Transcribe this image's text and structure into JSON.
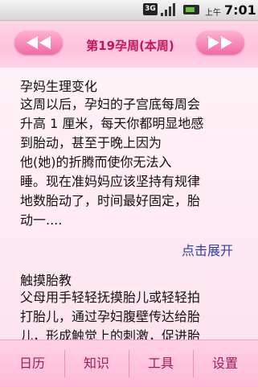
{
  "status": {
    "network": "3G",
    "ampm": "上午",
    "time": "7:01"
  },
  "header": {
    "week_title": "第19孕周(本周)"
  },
  "sections": [
    {
      "title": "孕妈生理变化",
      "lines": [
        "这周以后，孕妇的子宫底每周会",
        "升高 1 厘米，每天你都明显地感",
        "到胎动，甚至于晚上因为",
        "他(她)的折腾而使你无法入",
        "睡。现在准妈妈应该坚持有规律",
        "地数胎动了，时间最好固定，胎",
        "动一...."
      ],
      "expand_label": "点击展开"
    },
    {
      "title": "触摸胎教",
      "lines": [
        "父母用手轻轻抚摸胎儿或轻轻拍",
        "打胎儿，通过孕妇腹壁传达给胎",
        "儿，形成触觉上的刺激，促进胎"
      ]
    }
  ],
  "tabs": [
    "日历",
    "知识",
    "工具",
    "设置"
  ]
}
